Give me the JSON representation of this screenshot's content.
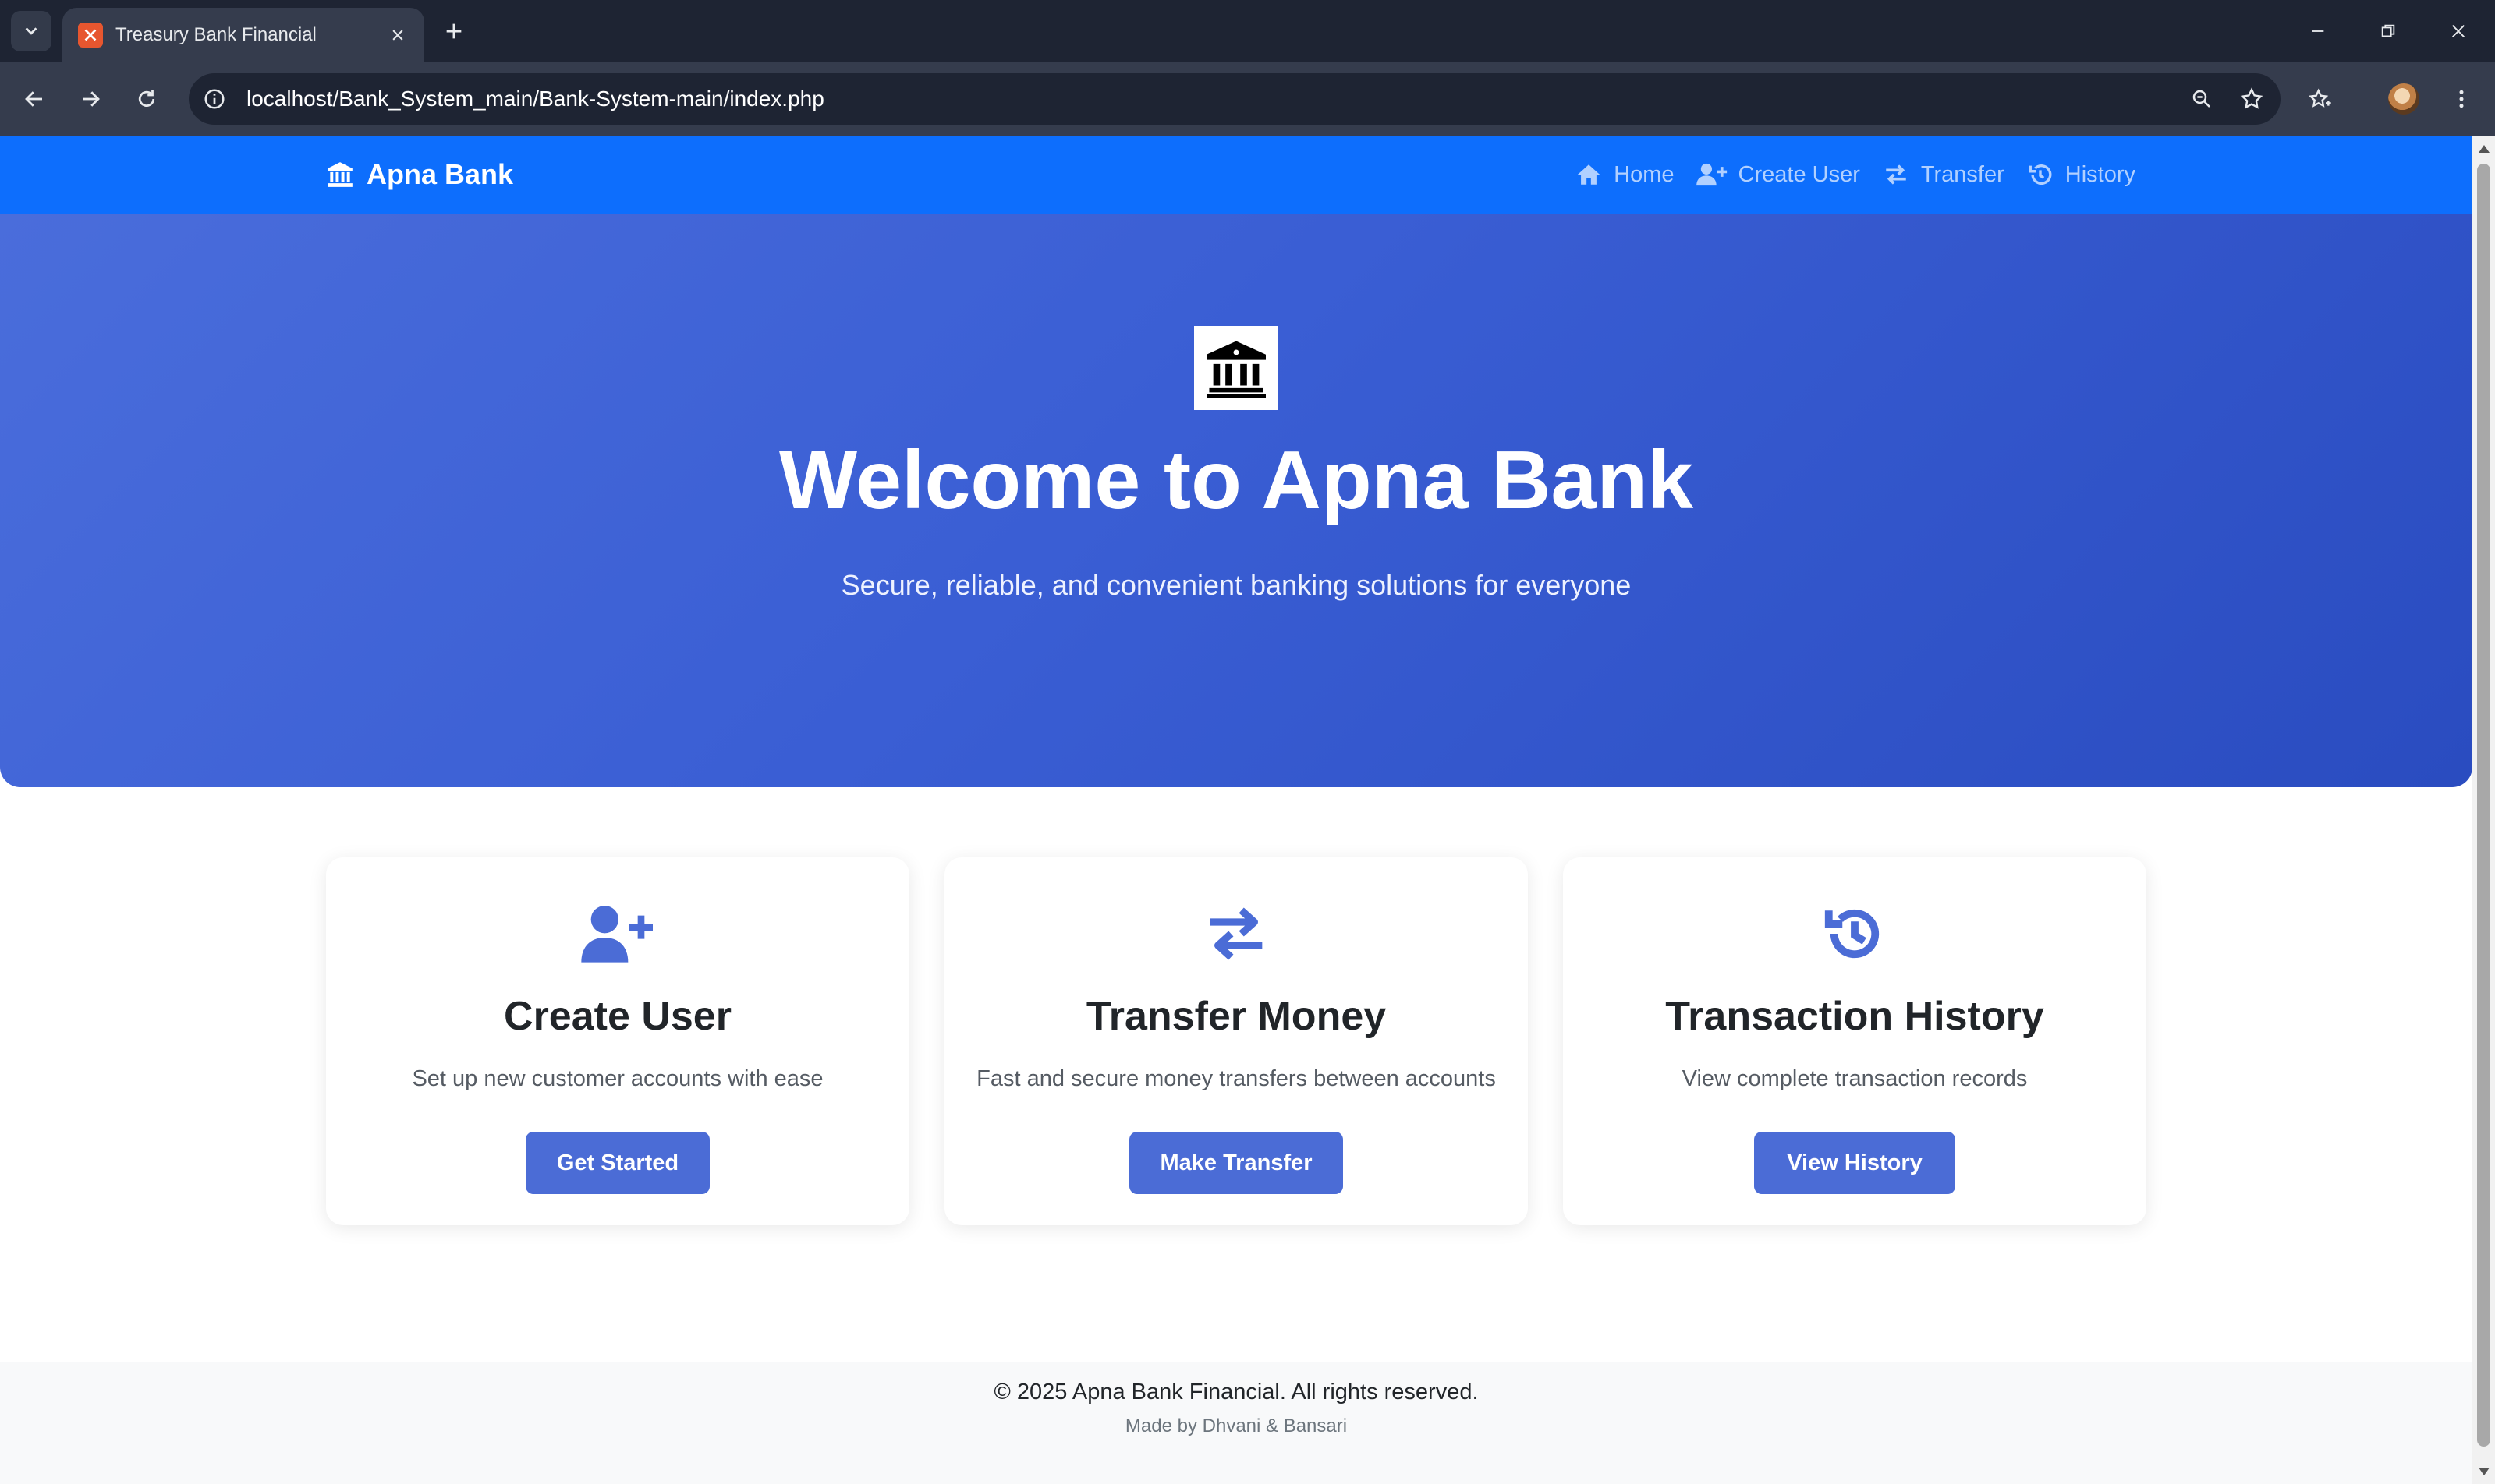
{
  "browser": {
    "tab_title": "Treasury Bank Financial",
    "url": "localhost/Bank_System_main/Bank-System-main/index.php"
  },
  "navbar": {
    "brand": "Apna Bank",
    "links": [
      {
        "label": "Home",
        "icon": "home-icon"
      },
      {
        "label": "Create User",
        "icon": "user-plus-icon"
      },
      {
        "label": "Transfer",
        "icon": "exchange-icon"
      },
      {
        "label": "History",
        "icon": "history-icon"
      }
    ],
    "background": "#0d6efd"
  },
  "hero": {
    "title": "Welcome to Apna Bank",
    "subtitle": "Secure, reliable, and convenient banking solutions for everyone",
    "icon": "bank-building-icon"
  },
  "cards": [
    {
      "title": "Create User",
      "description": "Set up new customer accounts with ease",
      "button": "Get Started",
      "icon": "user-plus-icon"
    },
    {
      "title": "Transfer Money",
      "description": "Fast and secure money transfers between accounts",
      "button": "Make Transfer",
      "icon": "exchange-icon"
    },
    {
      "title": "Transaction History",
      "description": "View complete transaction records",
      "button": "View History",
      "icon": "history-icon"
    }
  ],
  "footer": {
    "copyright": "© 2025 Apna Bank Financial. All rights reserved.",
    "credits": "Made by Dhvani & Bansari"
  },
  "colors": {
    "accent": "#4b6cd6",
    "hero_gradient_start": "#4a6ddb",
    "hero_gradient_end": "#2a4cc0"
  }
}
